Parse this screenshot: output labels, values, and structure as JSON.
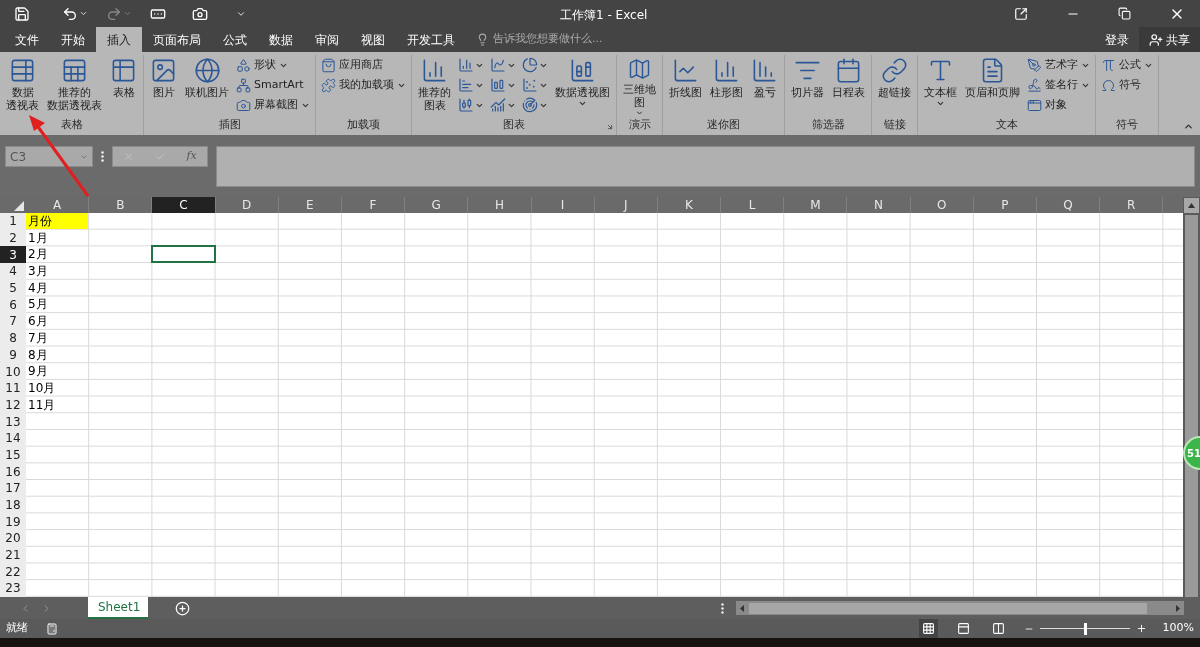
{
  "title_bar": {
    "title": "工作簿1 - Excel"
  },
  "menu_tabs": [
    {
      "label": "文件",
      "selected": false
    },
    {
      "label": "开始",
      "selected": false
    },
    {
      "label": "插入",
      "selected": true
    },
    {
      "label": "页面布局",
      "selected": false
    },
    {
      "label": "公式",
      "selected": false
    },
    {
      "label": "数据",
      "selected": false
    },
    {
      "label": "审阅",
      "selected": false
    },
    {
      "label": "视图",
      "selected": false
    },
    {
      "label": "开发工具",
      "selected": false
    }
  ],
  "tell_me": {
    "placeholder": "告诉我您想要做什么..."
  },
  "account": {
    "sign_in": "登录",
    "share": "共享"
  },
  "ribbon": [
    {
      "label": "表格",
      "items": [
        {
          "kind": "large",
          "lines": [
            "数据",
            "透视表"
          ],
          "dropdown": false
        },
        {
          "kind": "large",
          "lines": [
            "推荐的",
            "数据透视表"
          ],
          "dropdown": false
        },
        {
          "kind": "large",
          "lines": [
            "表格"
          ],
          "dropdown": false
        }
      ]
    },
    {
      "label": "插图",
      "items": [
        {
          "kind": "large",
          "lines": [
            "图片"
          ],
          "dropdown": false
        },
        {
          "kind": "large",
          "lines": [
            "联机图片"
          ],
          "dropdown": false
        },
        {
          "kind": "small",
          "label": "形状",
          "dropdown": true
        },
        {
          "kind": "small",
          "label": "SmartArt",
          "dropdown": false
        },
        {
          "kind": "small",
          "label": "屏幕截图",
          "dropdown": true
        }
      ]
    },
    {
      "label": "加载项",
      "items": [
        {
          "kind": "small",
          "label": "应用商店",
          "dropdown": false
        },
        {
          "kind": "small",
          "label": "我的加载项",
          "dropdown": true
        }
      ]
    },
    {
      "label": "图表",
      "launcher": true,
      "items": [
        {
          "kind": "large",
          "lines": [
            "推荐的",
            "图表"
          ],
          "dropdown": false
        },
        {
          "kind": "icon",
          "dropdown": true
        },
        {
          "kind": "icon",
          "dropdown": true
        },
        {
          "kind": "icon",
          "dropdown": true
        },
        {
          "kind": "icon",
          "dropdown": true
        },
        {
          "kind": "icon",
          "dropdown": true
        },
        {
          "kind": "icon",
          "dropdown": true
        },
        {
          "kind": "icon",
          "dropdown": true
        },
        {
          "kind": "icon",
          "dropdown": true
        },
        {
          "kind": "icon",
          "dropdown": true
        },
        {
          "kind": "large",
          "lines": [
            "数据透视图"
          ],
          "dropdown": true
        }
      ]
    },
    {
      "label": "演示",
      "items": [
        {
          "kind": "large",
          "lines": [
            "三维地",
            "图"
          ],
          "dropdown": true
        }
      ]
    },
    {
      "label": "迷你图",
      "items": [
        {
          "kind": "large",
          "lines": [
            "折线图"
          ],
          "dropdown": false
        },
        {
          "kind": "large",
          "lines": [
            "柱形图"
          ],
          "dropdown": false
        },
        {
          "kind": "large",
          "lines": [
            "盈亏"
          ],
          "dropdown": false
        }
      ]
    },
    {
      "label": "筛选器",
      "items": [
        {
          "kind": "large",
          "lines": [
            "切片器"
          ],
          "dropdown": false
        },
        {
          "kind": "large",
          "lines": [
            "日程表"
          ],
          "dropdown": false
        }
      ]
    },
    {
      "label": "链接",
      "items": [
        {
          "kind": "large",
          "lines": [
            "超链接"
          ],
          "dropdown": false
        }
      ]
    },
    {
      "label": "文本",
      "items": [
        {
          "kind": "large",
          "lines": [
            "文本框"
          ],
          "dropdown": true
        },
        {
          "kind": "large",
          "lines": [
            "页眉和页脚"
          ],
          "dropdown": false
        },
        {
          "kind": "small",
          "label": "艺术字",
          "dropdown": true
        },
        {
          "kind": "small",
          "label": "签名行",
          "dropdown": true
        },
        {
          "kind": "small",
          "label": "对象",
          "dropdown": false
        }
      ]
    },
    {
      "label": "符号",
      "items": [
        {
          "kind": "small",
          "label": "公式",
          "dropdown": true
        },
        {
          "kind": "small",
          "label": "符号",
          "dropdown": false
        }
      ]
    }
  ],
  "formula_bar": {
    "name_box": "C3",
    "insert_function": "fx"
  },
  "columns": [
    {
      "label": "A",
      "selected": false
    },
    {
      "label": "B",
      "selected": false
    },
    {
      "label": "C",
      "selected": true
    },
    {
      "label": "D",
      "selected": false
    },
    {
      "label": "E",
      "selected": false
    },
    {
      "label": "F",
      "selected": false
    },
    {
      "label": "G",
      "selected": false
    },
    {
      "label": "H",
      "selected": false
    },
    {
      "label": "I",
      "selected": false
    },
    {
      "label": "J",
      "selected": false
    },
    {
      "label": "K",
      "selected": false
    },
    {
      "label": "L",
      "selected": false
    },
    {
      "label": "M",
      "selected": false
    },
    {
      "label": "N",
      "selected": false
    },
    {
      "label": "O",
      "selected": false
    },
    {
      "label": "P",
      "selected": false
    },
    {
      "label": "Q",
      "selected": false
    },
    {
      "label": "R",
      "selected": false
    }
  ],
  "rows": [
    {
      "number": "1",
      "selected": false,
      "cells": [
        {
          "text": "月份",
          "highlighted": true
        }
      ]
    },
    {
      "number": "2",
      "selected": false,
      "cells": [
        {
          "text": "1月",
          "highlighted": false
        }
      ]
    },
    {
      "number": "3",
      "selected": true,
      "cells": [
        {
          "text": "2月",
          "highlighted": false
        }
      ]
    },
    {
      "number": "4",
      "selected": false,
      "cells": [
        {
          "text": "3月",
          "highlighted": false
        }
      ]
    },
    {
      "number": "5",
      "selected": false,
      "cells": [
        {
          "text": "4月",
          "highlighted": false
        }
      ]
    },
    {
      "number": "6",
      "selected": false,
      "cells": [
        {
          "text": "5月",
          "highlighted": false
        }
      ]
    },
    {
      "number": "7",
      "selected": false,
      "cells": [
        {
          "text": "6月",
          "highlighted": false
        }
      ]
    },
    {
      "number": "8",
      "selected": false,
      "cells": [
        {
          "text": "7月",
          "highlighted": false
        }
      ]
    },
    {
      "number": "9",
      "selected": false,
      "cells": [
        {
          "text": "8月",
          "highlighted": false
        }
      ]
    },
    {
      "number": "10",
      "selected": false,
      "cells": [
        {
          "text": "9月",
          "highlighted": false
        }
      ]
    },
    {
      "number": "11",
      "selected": false,
      "cells": [
        {
          "text": "10月",
          "highlighted": false
        }
      ]
    },
    {
      "number": "12",
      "selected": false,
      "cells": [
        {
          "text": "11月",
          "highlighted": false
        }
      ]
    },
    {
      "number": "13",
      "selected": false,
      "cells": []
    },
    {
      "number": "14",
      "selected": false,
      "cells": []
    },
    {
      "number": "15",
      "selected": false,
      "cells": []
    },
    {
      "number": "16",
      "selected": false,
      "cells": []
    },
    {
      "number": "17",
      "selected": false,
      "cells": []
    },
    {
      "number": "18",
      "selected": false,
      "cells": []
    },
    {
      "number": "19",
      "selected": false,
      "cells": []
    },
    {
      "number": "20",
      "selected": false,
      "cells": []
    },
    {
      "number": "21",
      "selected": false,
      "cells": []
    },
    {
      "number": "22",
      "selected": false,
      "cells": []
    },
    {
      "number": "23",
      "selected": false,
      "cells": []
    }
  ],
  "sheet_tabs": [
    {
      "label": "Sheet1",
      "selected": true
    }
  ],
  "status_bar": {
    "status": "就绪",
    "views": [
      {
        "kind": "normal",
        "selected": true
      },
      {
        "kind": "layout",
        "selected": false
      },
      {
        "kind": "break",
        "selected": false
      }
    ],
    "zoom": {
      "level": 0.5,
      "reading": "100%"
    }
  },
  "floating_badge": {
    "text": "51"
  }
}
